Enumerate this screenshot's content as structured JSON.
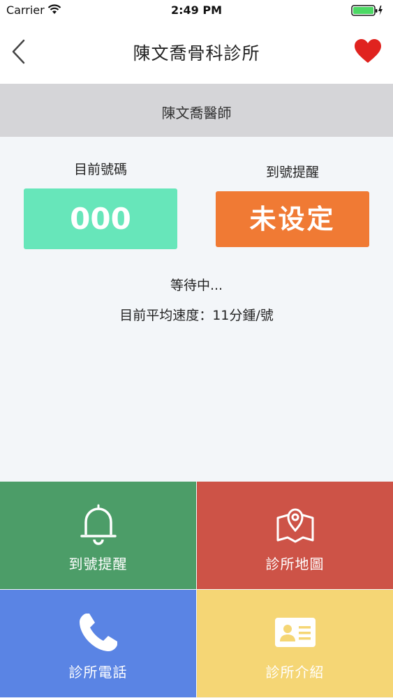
{
  "status_bar": {
    "carrier": "Carrier",
    "time": "2:49 PM"
  },
  "nav": {
    "title": "陳文喬骨科診所"
  },
  "doctor": {
    "name": "陳文喬醫師"
  },
  "queue": {
    "current_label": "目前號碼",
    "current_number": "000",
    "reminder_label": "到號提醒",
    "reminder_value": "未设定",
    "status": "等待中...",
    "speed": "目前平均速度：11分鍾/號"
  },
  "menu": {
    "remind": "到號提醒",
    "map": "診所地圖",
    "phone": "診所電話",
    "intro": "診所介紹"
  },
  "colors": {
    "current_box": "#67e6ba",
    "reminder_box": "#f07a34",
    "tile_remind": "#4c9d68",
    "tile_map": "#cd5347",
    "tile_phone": "#5a84e4",
    "tile_intro": "#f5d675",
    "heart": "#e0231f"
  }
}
